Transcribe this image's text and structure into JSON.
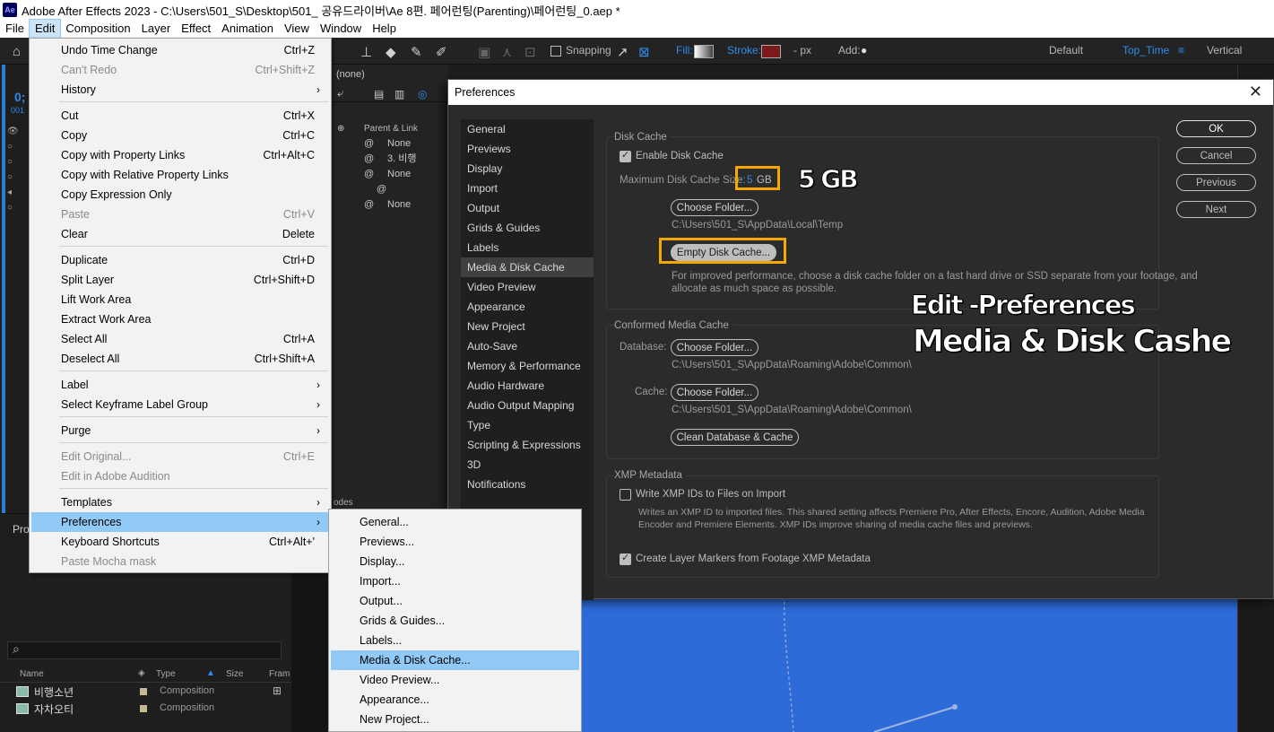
{
  "titlebar": {
    "logo": "Ae",
    "title": "Adobe After Effects 2023 - C:\\Users\\501_S\\Desktop\\501_ 공유드라이버\\Ae 8편. 페어런팅(Parenting)\\페어런팅_0.aep *"
  },
  "menubar": [
    "File",
    "Edit",
    "Composition",
    "Layer",
    "Effect",
    "Animation",
    "View",
    "Window",
    "Help"
  ],
  "toolbar": {
    "snapping_label": "Snapping",
    "fill_label": "Fill:",
    "stroke_label": "Stroke:",
    "px_label": "- px",
    "add_label": "Add:",
    "workspaces": [
      "Default",
      "Top_Time",
      "Vertical"
    ],
    "active_workspace": "Top_Time",
    "menu_icon": "≡"
  },
  "edit_menu": {
    "items": [
      {
        "label": "Undo Time Change",
        "shortcut": "Ctrl+Z",
        "disabled": false
      },
      {
        "label": "Can't Redo",
        "shortcut": "Ctrl+Shift+Z",
        "disabled": true
      },
      {
        "label": "History",
        "arrow": "›",
        "disabled": false
      },
      {
        "label": "Cut",
        "shortcut": "Ctrl+X",
        "disabled": false
      },
      {
        "label": "Copy",
        "shortcut": "Ctrl+C",
        "disabled": false
      },
      {
        "label": "Copy with Property Links",
        "shortcut": "Ctrl+Alt+C",
        "disabled": false
      },
      {
        "label": "Copy with Relative Property Links",
        "shortcut": "",
        "disabled": false
      },
      {
        "label": "Copy Expression Only",
        "shortcut": "",
        "disabled": false
      },
      {
        "label": "Paste",
        "shortcut": "Ctrl+V",
        "disabled": true
      },
      {
        "label": "Clear",
        "shortcut": "Delete",
        "disabled": false
      },
      {
        "label": "Duplicate",
        "shortcut": "Ctrl+D",
        "disabled": false
      },
      {
        "label": "Split Layer",
        "shortcut": "Ctrl+Shift+D",
        "disabled": false
      },
      {
        "label": "Lift Work Area",
        "shortcut": "",
        "disabled": false
      },
      {
        "label": "Extract Work Area",
        "shortcut": "",
        "disabled": false
      },
      {
        "label": "Select All",
        "shortcut": "Ctrl+A",
        "disabled": false
      },
      {
        "label": "Deselect All",
        "shortcut": "Ctrl+Shift+A",
        "disabled": false
      },
      {
        "label": "Label",
        "arrow": "›",
        "disabled": false
      },
      {
        "label": "Select Keyframe Label Group",
        "arrow": "›",
        "disabled": false
      },
      {
        "label": "Purge",
        "arrow": "›",
        "disabled": false
      },
      {
        "label": "Edit Original...",
        "shortcut": "Ctrl+E",
        "disabled": true
      },
      {
        "label": "Edit in Adobe Audition",
        "shortcut": "",
        "disabled": true
      },
      {
        "label": "Templates",
        "arrow": "›",
        "disabled": false
      },
      {
        "label": "Preferences",
        "arrow": "›",
        "disabled": false,
        "highlight": true
      },
      {
        "label": "Keyboard Shortcuts",
        "shortcut": "Ctrl+Alt+'",
        "disabled": false
      },
      {
        "label": "Paste Mocha mask",
        "shortcut": "",
        "disabled": true
      }
    ]
  },
  "pref_submenu": [
    "General...",
    "Previews...",
    "Display...",
    "Import...",
    "Output...",
    "Grids & Guides...",
    "Labels...",
    "Media & Disk Cache...",
    "Video Preview...",
    "Appearance...",
    "New Project..."
  ],
  "pref_submenu_selected": "Media & Disk Cache...",
  "timeline": {
    "none_label": "(none)",
    "parent_header": "Parent & Link",
    "rows": [
      "None",
      "3. 비행",
      "None",
      "",
      "None"
    ],
    "time_partial": "0;",
    "time_sub": "001",
    "modes_label": "odes"
  },
  "project": {
    "panel_label": "Pro",
    "search_icon": "⌕",
    "columns": [
      "Name",
      "Type",
      "Size",
      "Fram"
    ],
    "items": [
      {
        "name": "비행소년",
        "type": "Composition"
      },
      {
        "name": "자차오티",
        "type": "Composition"
      }
    ]
  },
  "preferences": {
    "title": "Preferences",
    "close": "✕",
    "categories": [
      "General",
      "Previews",
      "Display",
      "Import",
      "Output",
      "Grids & Guides",
      "Labels",
      "Media & Disk Cache",
      "Video Preview",
      "Appearance",
      "New Project",
      "Auto-Save",
      "Memory & Performance",
      "Audio Hardware",
      "Audio Output Mapping",
      "Type",
      "Scripting & Expressions",
      "3D",
      "Notifications"
    ],
    "selected_category": "Media & Disk Cache",
    "disk_cache": {
      "title": "Disk Cache",
      "enable_label": "Enable Disk Cache",
      "enabled": true,
      "max_size_label": "Maximum Disk Cache Size:",
      "max_size_value": "5",
      "max_size_unit": "GB",
      "choose_folder": "Choose Folder...",
      "path": "C:\\Users\\501_S\\AppData\\Local\\Temp",
      "empty_button": "Empty Disk Cache...",
      "hint_line1": "For improved performance, choose a disk cache folder on a fast hard drive or SSD separate from your footage, and",
      "hint_line2": "allocate as much space as possible."
    },
    "conformed": {
      "title": "Conformed Media Cache",
      "database_label": "Database:",
      "database_button": "Choose Folder...",
      "database_path": "C:\\Users\\501_S\\AppData\\Roaming\\Adobe\\Common\\",
      "cache_label": "Cache:",
      "cache_button": "Choose Folder...",
      "cache_path": "C:\\Users\\501_S\\AppData\\Roaming\\Adobe\\Common\\",
      "clean_button": "Clean Database & Cache"
    },
    "xmp": {
      "title": "XMP Metadata",
      "write_label": "Write XMP IDs to Files on Import",
      "write_checked": false,
      "desc_line1": "Writes an XMP ID to imported files. This shared setting affects Premiere Pro, After Effects, Encore, Audition, Adobe Media",
      "desc_line2": "Encoder and Premiere Elements. XMP IDs improve sharing of media cache files and previews.",
      "markers_label": "Create Layer Markers from Footage XMP Metadata",
      "markers_checked": true
    },
    "buttons": [
      "OK",
      "Cancel",
      "Previous",
      "Next"
    ]
  },
  "annotations": {
    "size": "5 GB",
    "line1": "Edit -Preferences",
    "line2": "Media & Disk Cashe"
  },
  "colors": {
    "highlight": "#91c9f7",
    "annotation_box": "#f5a800",
    "accent_blue": "#2d8ceb",
    "comp_blue": "#2d6bd9"
  }
}
